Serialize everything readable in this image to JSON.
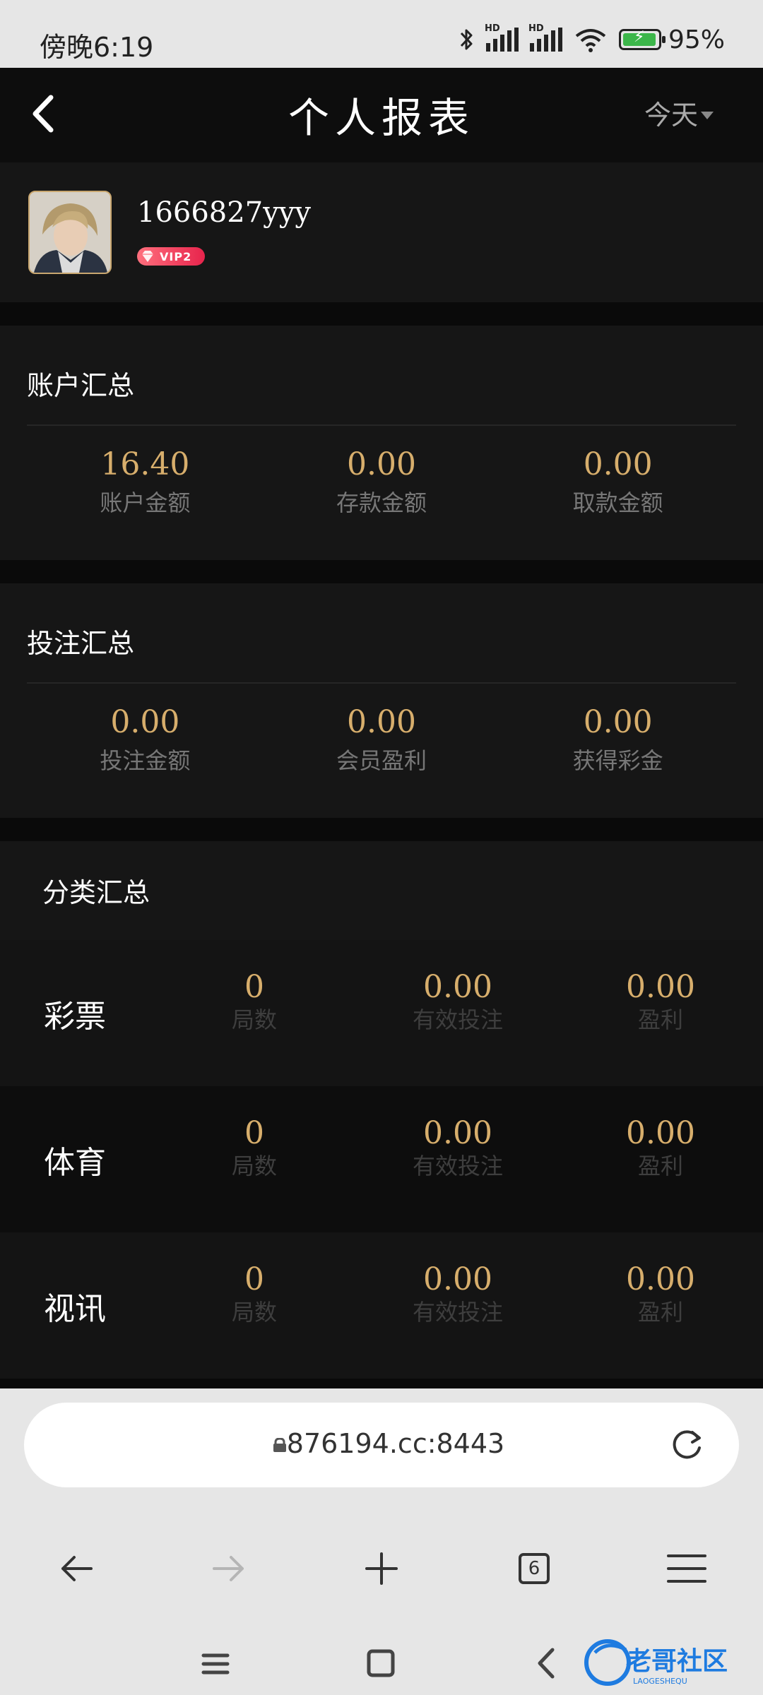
{
  "status_bar": {
    "time": "傍晚6:19",
    "battery": "95%",
    "network_labels": [
      "HD",
      "HD"
    ]
  },
  "header": {
    "title": "个人报表",
    "date_filter": "今天"
  },
  "profile": {
    "username": "1666827yyy",
    "vip_badge": "VIP2"
  },
  "account_summary": {
    "title": "账户汇总",
    "items": [
      {
        "value": "16.40",
        "label": "账户金额"
      },
      {
        "value": "0.00",
        "label": "存款金额"
      },
      {
        "value": "0.00",
        "label": "取款金额"
      }
    ]
  },
  "bet_summary": {
    "title": "投注汇总",
    "items": [
      {
        "value": "0.00",
        "label": "投注金额"
      },
      {
        "value": "0.00",
        "label": "会员盈利"
      },
      {
        "value": "0.00",
        "label": "获得彩金"
      }
    ]
  },
  "category_summary": {
    "title": "分类汇总",
    "rows": [
      {
        "name": "彩票",
        "rounds": "0",
        "rounds_label": "局数",
        "valid_bet": "0.00",
        "valid_bet_label": "有效投注",
        "profit": "0.00",
        "profit_label": "盈利"
      },
      {
        "name": "体育",
        "rounds": "0",
        "rounds_label": "局数",
        "valid_bet": "0.00",
        "valid_bet_label": "有效投注",
        "profit": "0.00",
        "profit_label": "盈利"
      },
      {
        "name": "视讯",
        "rounds": "0",
        "rounds_label": "局数",
        "valid_bet": "0.00",
        "valid_bet_label": "有效投注",
        "profit": "0.00",
        "profit_label": "盈利"
      }
    ]
  },
  "browser": {
    "url": "876194.cc:8443",
    "tab_count": "6"
  },
  "icons": {
    "back": "back-arrow-icon",
    "dropdown": "caret-down-icon",
    "lock": "lock-icon",
    "reload": "reload-icon",
    "browser_back": "arrow-left-icon",
    "browser_forward": "arrow-right-icon",
    "new_tab": "plus-icon",
    "tabs": "tabs-icon",
    "menu": "menu-icon",
    "vip_gem": "diamond-icon"
  },
  "colors": {
    "accent_gold": "#d7ae6c",
    "background": "#0a0a0a",
    "card": "#161616",
    "vip_badge": "#e7244c",
    "battery": "#3cb64a"
  }
}
